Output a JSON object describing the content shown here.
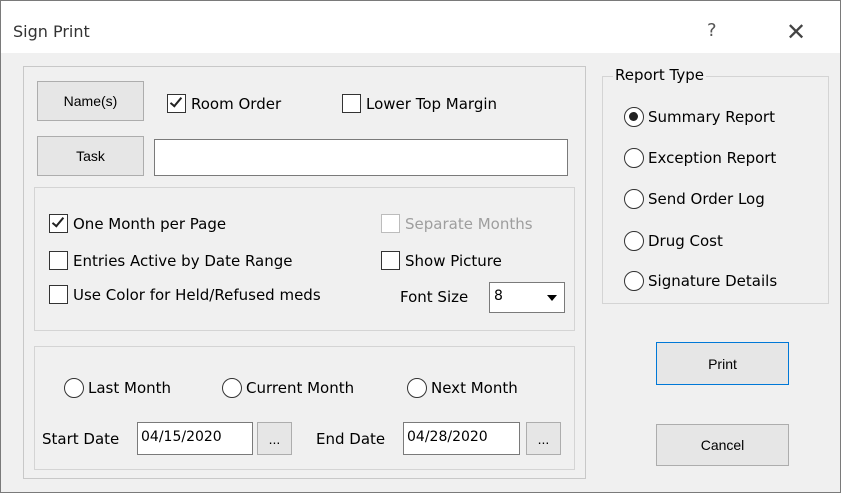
{
  "window": {
    "title": "Sign Print",
    "help_label": "?",
    "close_label": "✕"
  },
  "top": {
    "names_button": "Name(s)",
    "room_order": {
      "label": "Room Order",
      "checked": true
    },
    "lower_top_margin": {
      "label": "Lower Top Margin",
      "checked": false
    },
    "task_button": "Task",
    "task_value": ""
  },
  "options": {
    "one_month_per_page": {
      "label": "One Month per Page",
      "checked": true
    },
    "separate_months": {
      "label": "Separate Months",
      "checked": false,
      "disabled": true
    },
    "entries_active": {
      "label": "Entries Active by Date Range",
      "checked": false
    },
    "show_picture": {
      "label": "Show Picture",
      "checked": false
    },
    "use_color": {
      "label": "Use Color for Held/Refused meds",
      "checked": false
    },
    "font_size_label": "Font Size",
    "font_size_value": "8"
  },
  "dates": {
    "last_month": "Last Month",
    "current_month": "Current Month",
    "next_month": "Next Month",
    "start_date_label": "Start Date",
    "start_date_value": "04/15/2020",
    "end_date_label": "End Date",
    "end_date_value": "04/28/2020",
    "picker_label": "..."
  },
  "report_type": {
    "legend": "Report Type",
    "selected": "Summary Report",
    "options": [
      "Summary Report",
      "Exception Report",
      "Send Order Log",
      "Drug Cost",
      "Signature Details"
    ]
  },
  "actions": {
    "print": "Print",
    "cancel": "Cancel"
  }
}
